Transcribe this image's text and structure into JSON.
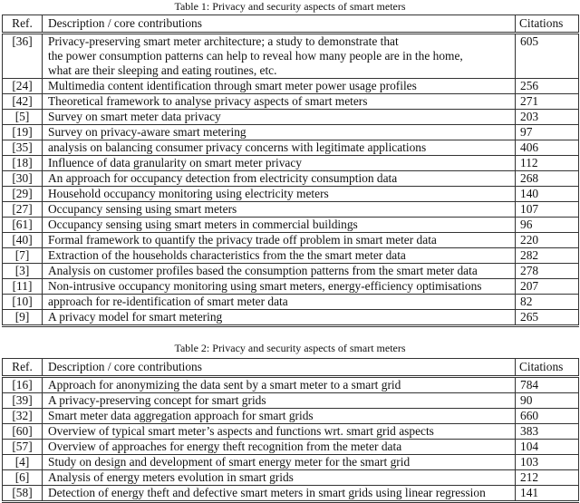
{
  "tables": [
    {
      "caption": "Table 1: Privacy and security aspects of smart meters",
      "headers": {
        "ref": "Ref.",
        "description": "Description / core contributions",
        "citations": "Citations"
      },
      "rows": [
        {
          "ref": "[36]",
          "description": [
            "Privacy-preserving smart meter architecture; a study to demonstrate that",
            "the power consumption patterns can help to reveal how many people are in the home,",
            "what are their sleeping and eating routines, etc."
          ],
          "citations": "605"
        },
        {
          "ref": "[24]",
          "description": [
            "Multimedia content identification through smart meter power usage profiles"
          ],
          "citations": "256"
        },
        {
          "ref": "[42]",
          "description": [
            "Theoretical framework to analyse privacy aspects of smart meters"
          ],
          "citations": "271"
        },
        {
          "ref": "[5]",
          "description": [
            "Survey on smart meter data privacy"
          ],
          "citations": "203"
        },
        {
          "ref": "[19]",
          "description": [
            "Survey on privacy-aware smart metering"
          ],
          "citations": "97"
        },
        {
          "ref": "[35]",
          "description": [
            "analysis on balancing consumer privacy concerns with legitimate applications"
          ],
          "citations": "406"
        },
        {
          "ref": "[18]",
          "description": [
            "Influence of data granularity on smart meter privacy"
          ],
          "citations": "112"
        },
        {
          "ref": "[30]",
          "description": [
            "An approach for occupancy detection from electricity consumption data"
          ],
          "citations": "268"
        },
        {
          "ref": "[29]",
          "description": [
            "Household occupancy monitoring using electricity meters"
          ],
          "citations": "140"
        },
        {
          "ref": "[27]",
          "description": [
            "Occupancy sensing using smart meters"
          ],
          "citations": "107"
        },
        {
          "ref": "[61]",
          "description": [
            "Occupancy sensing using smart meters in commercial buildings"
          ],
          "citations": "96"
        },
        {
          "ref": "[40]",
          "description": [
            "Formal framework to quantify the privacy trade off problem in smart meter data"
          ],
          "citations": "220"
        },
        {
          "ref": "[7]",
          "description": [
            "Extraction of the households characteristics from the the smart meter data"
          ],
          "citations": "282"
        },
        {
          "ref": "[3]",
          "description": [
            "Analysis on customer profiles based the consumption patterns from the smart meter data"
          ],
          "citations": "278"
        },
        {
          "ref": "[11]",
          "description": [
            "Non-intrusive occupancy monitoring using smart meters, energy-efficiency optimisations"
          ],
          "citations": "207"
        },
        {
          "ref": "[10]",
          "description": [
            "approach for re-identification of smart meter data"
          ],
          "citations": "82"
        },
        {
          "ref": "[9]",
          "description": [
            "A privacy model for smart metering"
          ],
          "citations": "265"
        }
      ]
    },
    {
      "caption": "Table 2: Privacy and security aspects of smart meters",
      "headers": {
        "ref": "Ref.",
        "description": "Description / core contributions",
        "citations": "Citations"
      },
      "rows": [
        {
          "ref": "[16]",
          "description": [
            "Approach for anonymizing the data sent by a smart meter to a smart grid"
          ],
          "citations": "784"
        },
        {
          "ref": "[39]",
          "description": [
            "A privacy-preserving concept for smart grids"
          ],
          "citations": "90"
        },
        {
          "ref": "[32]",
          "description": [
            "Smart meter data aggregation approach for smart grids"
          ],
          "citations": "660"
        },
        {
          "ref": "[60]",
          "description": [
            "Overview of typical smart meter’s aspects and functions wrt. smart grid aspects"
          ],
          "citations": "383"
        },
        {
          "ref": "[57]",
          "description": [
            "Overview of approaches for energy theft recognition from the meter data"
          ],
          "citations": "104"
        },
        {
          "ref": "[4]",
          "description": [
            "Study on design and development of smart energy meter for the smart grid"
          ],
          "citations": "103"
        },
        {
          "ref": "[6]",
          "description": [
            "Analysis of energy meters evolution in smart grids"
          ],
          "citations": "212"
        },
        {
          "ref": "[58]",
          "description": [
            "Detection of energy theft and defective smart meters in smart grids using linear regression"
          ],
          "citations": "141"
        }
      ]
    }
  ]
}
